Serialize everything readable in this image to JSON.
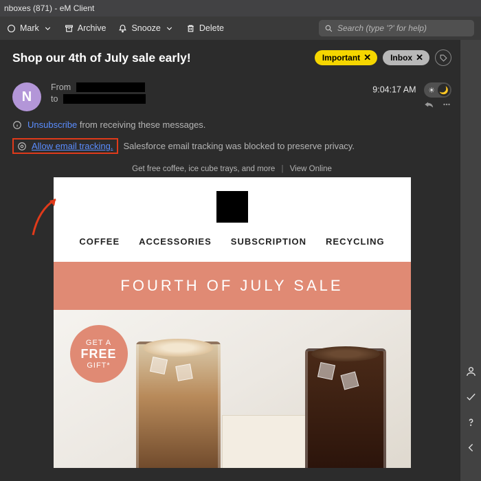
{
  "window": {
    "title": "nboxes (871) - eM Client"
  },
  "toolbar": {
    "mark": "Mark",
    "archive": "Archive",
    "snooze": "Snooze",
    "delete": "Delete",
    "search_placeholder": "Search (type '?' for help)"
  },
  "message": {
    "subject": "Shop our 4th of July sale early!",
    "tags": {
      "important": "Important",
      "inbox": "Inbox"
    },
    "avatar_initial": "N",
    "from_label": "From",
    "to_label": "to",
    "time": "9:04:17 AM",
    "unsubscribe": {
      "link": "Unsubscribe",
      "rest": "from receiving these messages."
    },
    "tracking": {
      "link": "Allow email tracking.",
      "rest": "Salesforce email tracking was blocked to preserve privacy."
    }
  },
  "email": {
    "preheader": "Get free coffee, ice cube trays, and more",
    "view_online": "View Online",
    "nav": [
      "COFFEE",
      "ACCESSORIES",
      "SUBSCRIPTION",
      "RECYCLING"
    ],
    "banner": "FOURTH OF JULY SALE",
    "gift_badge": {
      "line1": "GET A",
      "line2": "FREE",
      "line3": "GIFT*"
    }
  }
}
